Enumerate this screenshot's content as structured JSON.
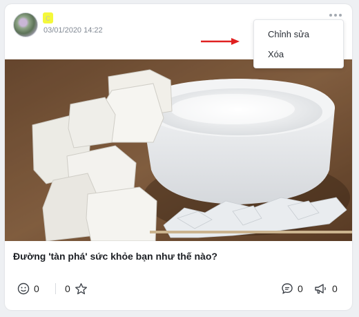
{
  "post": {
    "author_name": "c",
    "timestamp": "03/01/2020 14:22",
    "title": "Đường 'tàn phá' sức khỏe bạn như thế nào?",
    "image_icon": "sugar-photo"
  },
  "menu": {
    "edit_label": "Chỉnh sửa",
    "delete_label": "Xóa"
  },
  "actions": {
    "reaction_count": "0",
    "favorite_count": "0",
    "comment_count": "0",
    "share_count": "0"
  },
  "icons": {
    "more": "more-dots-icon",
    "reaction": "smiley-icon",
    "favorite": "star-icon",
    "comment": "comment-icon",
    "share": "megaphone-icon",
    "pointer": "red-arrow-icon"
  },
  "colors": {
    "arrow": "#e02020",
    "highlight": "#f4f83a",
    "muted_text": "#808893"
  }
}
